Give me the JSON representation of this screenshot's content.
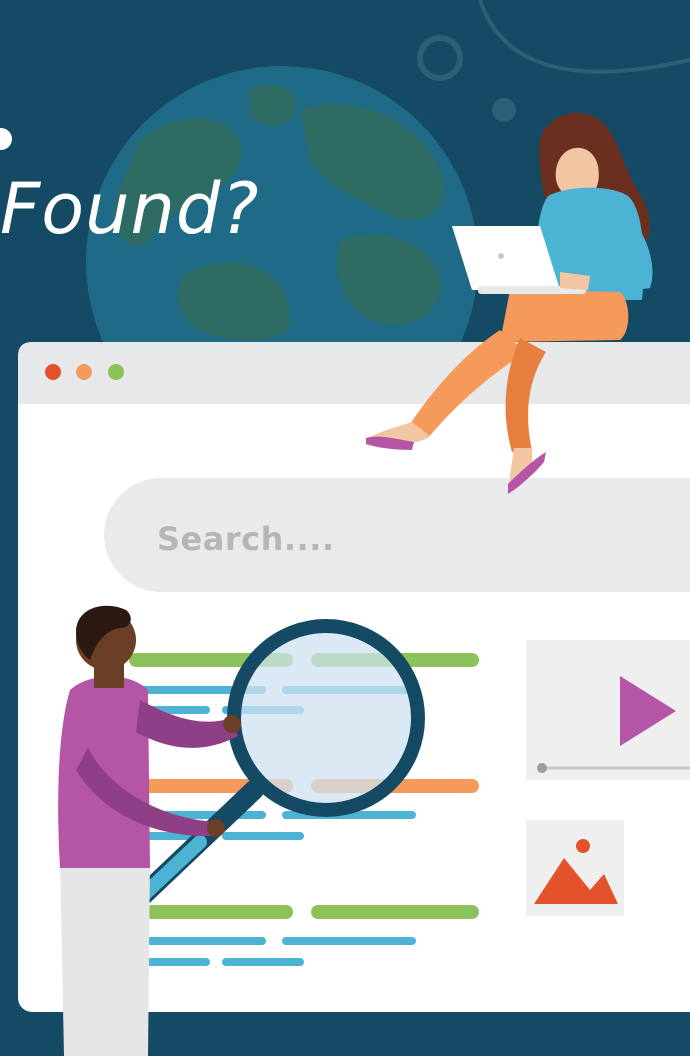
{
  "headline": {
    "text": "Found?"
  },
  "search": {
    "placeholder": "Search...."
  },
  "colors": {
    "background": "#144a63",
    "window_dot_red": "#e3522b",
    "window_dot_orange": "#f59a5a",
    "window_dot_green": "#8bc35a",
    "play_icon": "#b455a6",
    "image_icon": "#e3522b"
  },
  "icons": [
    "globe-icon",
    "play-icon",
    "image-placeholder-icon",
    "magnifying-glass-icon"
  ]
}
